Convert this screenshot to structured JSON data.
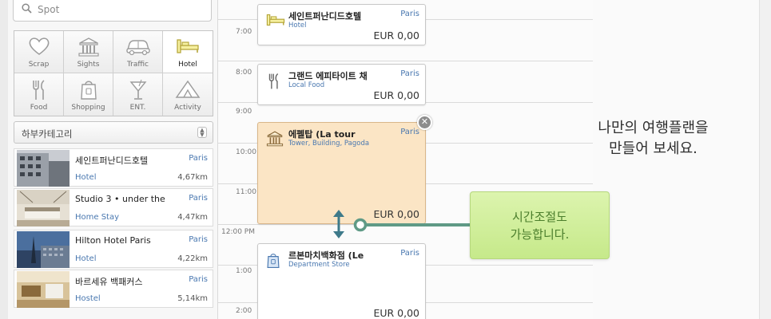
{
  "search": {
    "placeholder": "Spot",
    "icon": "search-icon"
  },
  "categories": [
    {
      "label": "Scrap",
      "icon": "heart-icon"
    },
    {
      "label": "Sights",
      "icon": "landmark-icon"
    },
    {
      "label": "Traffic",
      "icon": "car-icon"
    },
    {
      "label": "Hotel",
      "icon": "bed-icon",
      "selected": true
    },
    {
      "label": "Food",
      "icon": "fork-knife-icon"
    },
    {
      "label": "Shopping",
      "icon": "shopping-bag-icon"
    },
    {
      "label": "ENT.",
      "icon": "cocktail-icon"
    },
    {
      "label": "Activity",
      "icon": "tent-icon"
    }
  ],
  "subcategory": {
    "label": "하부카테고리"
  },
  "spots": [
    {
      "name": "세인트퍼난디드호텔",
      "city": "Paris",
      "type": "Hotel",
      "distance": "4,67km"
    },
    {
      "name": "Studio 3 • under the",
      "city": "Paris",
      "type": "Home Stay",
      "distance": "4,47km"
    },
    {
      "name": "Hilton Hotel Paris",
      "city": "Paris",
      "type": "Hotel",
      "distance": "4,22km"
    },
    {
      "name": "바르세유 백패커스",
      "city": "Paris",
      "type": "Hostel",
      "distance": "5,14km"
    }
  ],
  "hours": [
    "7:00",
    "8:00",
    "9:00",
    "10:00",
    "11:00",
    "12:00 PM",
    "1:00",
    "2:00"
  ],
  "schedule": [
    {
      "name": "세인트퍼난디드호텔",
      "sub": "Hotel",
      "city": "Paris",
      "price": "EUR 0,00",
      "icon": "bed-icon"
    },
    {
      "name": "그랜드 에피타이트 채",
      "sub": "Local Food",
      "city": "Paris",
      "price": "EUR 0,00",
      "icon": "fork-knife-icon"
    },
    {
      "name": "에펠탑 (La tour",
      "sub": "Tower, Building, Pagoda",
      "city": "Paris",
      "price": "EUR 0,00",
      "icon": "landmark-icon"
    },
    {
      "name": "르본마치백화점 (Le",
      "sub": "Department Store",
      "city": "Paris",
      "price": "EUR 0,00",
      "icon": "shopping-bag-icon"
    }
  ],
  "tooltip": {
    "text": "시간조절도\n가능합니다."
  },
  "promo": {
    "text": "나만의 여행플랜을\n만들어 보세요."
  },
  "colors": {
    "accent_blue": "#4a78b0",
    "active_card": "#fbe5c5",
    "tooltip_green": "#c6e98a",
    "connector": "#5f9a86"
  }
}
